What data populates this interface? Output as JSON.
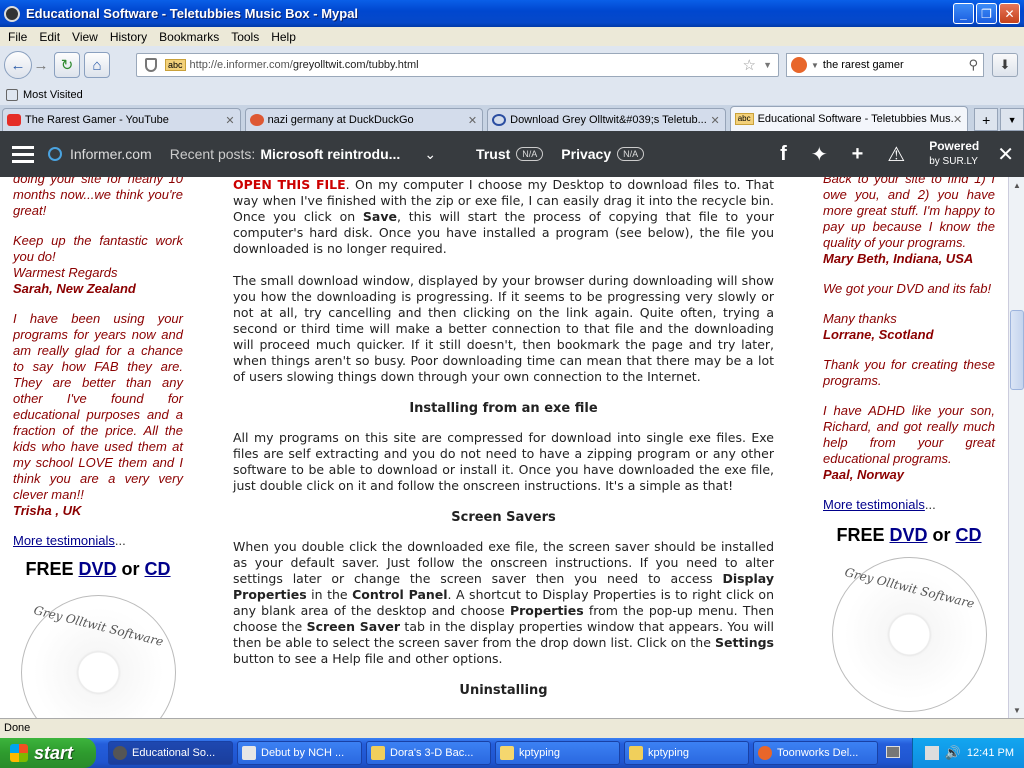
{
  "window": {
    "title": "Educational Software - Teletubbies Music Box - Mypal"
  },
  "menu": [
    "File",
    "Edit",
    "View",
    "History",
    "Bookmarks",
    "Tools",
    "Help"
  ],
  "nav": {
    "url_prefix": "http://e.informer.com/",
    "url_rest": "greyolltwit.com/tubby.html",
    "search_value": "the rarest gamer"
  },
  "bookmarks": {
    "most_visited": "Most Visited"
  },
  "tabs": [
    {
      "label": "The Rarest Gamer - YouTube",
      "color": "#e52d27"
    },
    {
      "label": "nazi germany at DuckDuckGo",
      "color": "#de5833"
    },
    {
      "label": "Download Grey Olltwit&#039;s Teletub...",
      "color": "#2b4ea1"
    },
    {
      "label": "Educational Software - Teletubbies Mus...",
      "color": "#f3d17a"
    }
  ],
  "informer": {
    "site": "Informer.com",
    "recent_label": "Recent posts:",
    "recent_post": "Microsoft reintrodu...",
    "trust": "Trust",
    "privacy": "Privacy",
    "na": "N/A",
    "powered": "Powered",
    "by": "by SUR.LY"
  },
  "left": {
    "t1_lines": "doing your site for nearly 10 months now...we think you're great!",
    "t2": "Keep up the fantastic work you do!",
    "t2b": "Warmest Regards",
    "a2": "Sarah, New Zealand",
    "t3": "I have been using your programs for years now and am really glad for a chance to say how FAB they are. They are better than any other I've found for educational purposes and a fraction of the price. All the kids who have used them at my school LOVE them and I think you are a very very clever man!!",
    "a3": "Trisha , UK",
    "more": "More testimonials",
    "free": "FREE",
    "dvd": "DVD",
    "or": "or",
    "cd": "CD",
    "logo": "Grey Olltwit Software"
  },
  "right": {
    "t1": "Back to your site to find 1) I owe you, and 2) you have more great stuff. I'm happy to pay up because I know the quality of your programs.",
    "a1": "Mary Beth, Indiana, USA",
    "t2": "We got your DVD and its fab!",
    "t3": "Many thanks",
    "a3": "Lorrane, Scotland",
    "t4": "Thank you for creating these programs.",
    "t5": "I have ADHD like your son, Richard, and got really much help from your great educational programs.",
    "a5": "Paal, Norway",
    "more": "More testimonials",
    "free": "FREE",
    "dvd": "DVD",
    "or": "or",
    "cd": "CD"
  },
  "main": {
    "p1_red": "OPEN THIS FILE",
    "p1a": ". On my computer I choose my Desktop to download files to. That way when I've finished with the zip or exe file, I can easily drag it into the recycle bin. Once you click on ",
    "p1_save": "Save",
    "p1b": ", this will start the process of copying that file to your computer's hard disk. Once you have installed a program (see below), the file you downloaded is no longer required.",
    "p2": "The small download window, displayed by your browser during downloading will show you how the downloading is progressing. If it seems to be progressing very slowly or not at all, try cancelling and then clicking on the link again. Quite often, trying a second or third time will make a better connection to that file and the downloading will proceed much quicker. If it still doesn't, then bookmark the page and try later, when things aren't so busy. Poor downloading time can mean that there may be a lot of users slowing things down through your own connection to the Internet.",
    "h1": "Installing from an exe file",
    "p3": "All my programs on this site are compressed for download into single exe files. Exe files are self extracting and you do not need to have a zipping program or any other software to be able to download or install it. Once you have downloaded the exe file, just double click on it and follow the onscreen instructions. It's a simple as that!",
    "h2": "Screen Savers",
    "p4a": "When you double click the downloaded exe file, the screen saver should be installed as your default saver. Just follow the onscreen instructions. If you need to alter settings later or change the screen saver then you need to access ",
    "p4_dp": "Display Properties",
    "p4b": " in the ",
    "p4_cp": "Control Panel",
    "p4c": ". A shortcut to Display Properties is to right click on any blank area of the desktop and choose ",
    "p4_pr": "Properties",
    "p4d": " from the pop-up menu. Then choose the ",
    "p4_ss": "Screen Saver",
    "p4e": " tab in the display properties window that appears. You will then be able to select the screen saver from the drop down list. Click on the ",
    "p4_st": "Settings",
    "p4f": " button to see a Help file and other options.",
    "h3": "Uninstalling"
  },
  "status": "Done",
  "taskbar": {
    "start": "start",
    "items": [
      "Educational So...",
      "Debut by NCH ...",
      "Dora's 3-D Bac...",
      "kptyping",
      "kptyping",
      "Toonworks Del..."
    ],
    "time": "12:41 PM"
  }
}
